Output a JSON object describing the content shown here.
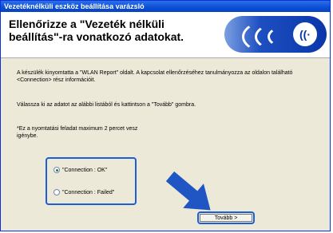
{
  "window": {
    "title": "Vezetéknélküli eszköz beállítása varázsló"
  },
  "header": {
    "title_line1": "Ellenőrizze a \"Vezeték nélküli",
    "title_line2": "beállítás\"-ra vonatkozó adatokat.",
    "logo_icon": "wifi-logo-icon"
  },
  "body": {
    "para1": "A készülék kinyomtatta a \"WLAN Report\" oldalt. A kapcsolat ellenőrzéséhez tanulmányozza az oldalon található <Connection> rész információit.",
    "para2": "Válassza ki az adatot az alábbi listából és kattintson a \"Tovább\" gombra.",
    "note": "*Ez a nyomtatási feladat maximum 2 percet vesz igénybe."
  },
  "options": [
    {
      "label": "\"Connection : OK\"",
      "selected": true
    },
    {
      "label": "\"Connection : Failed\"",
      "selected": false
    }
  ],
  "buttons": {
    "next": "Tovább >"
  },
  "colors": {
    "highlight": "#1a5fd6",
    "arrow": "#1f56c4"
  }
}
